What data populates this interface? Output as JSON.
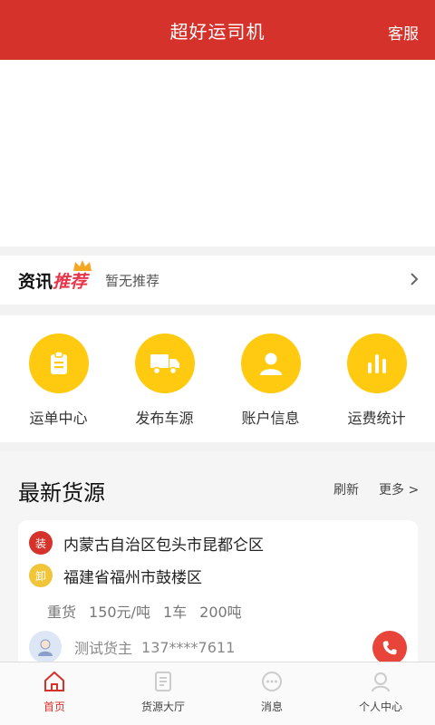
{
  "header": {
    "title": "超好运司机",
    "service_label": "客服"
  },
  "news": {
    "logo_black": "资讯",
    "logo_red": "推荐",
    "text": "暂无推荐"
  },
  "menu": {
    "items": [
      {
        "label": "运单中心",
        "icon": "clipboard-icon"
      },
      {
        "label": "发布车源",
        "icon": "truck-icon"
      },
      {
        "label": "账户信息",
        "icon": "user-icon"
      },
      {
        "label": "运费统计",
        "icon": "bar-chart-icon"
      }
    ]
  },
  "cargo": {
    "heading": "最新货源",
    "refresh_label": "刷新",
    "more_label": "更多 >",
    "item": {
      "load_badge": "装",
      "origin": "内蒙古自治区包头市昆都仑区",
      "unload_badge": "卸",
      "destination": "福建省福州市鼓楼区",
      "type": "重货",
      "price": "150元/吨",
      "vehicles": "1车",
      "weight": "200吨",
      "owner_name": "测试货主",
      "owner_phone": "137****7611"
    }
  },
  "tabbar": {
    "tabs": [
      {
        "label": "首页",
        "icon": "home-icon",
        "active": true
      },
      {
        "label": "货源大厅",
        "icon": "document-icon",
        "active": false
      },
      {
        "label": "消息",
        "icon": "message-icon",
        "active": false
      },
      {
        "label": "个人中心",
        "icon": "person-icon",
        "active": false
      }
    ]
  },
  "colors": {
    "brand": "#d5322c",
    "accent": "#ffca10"
  }
}
